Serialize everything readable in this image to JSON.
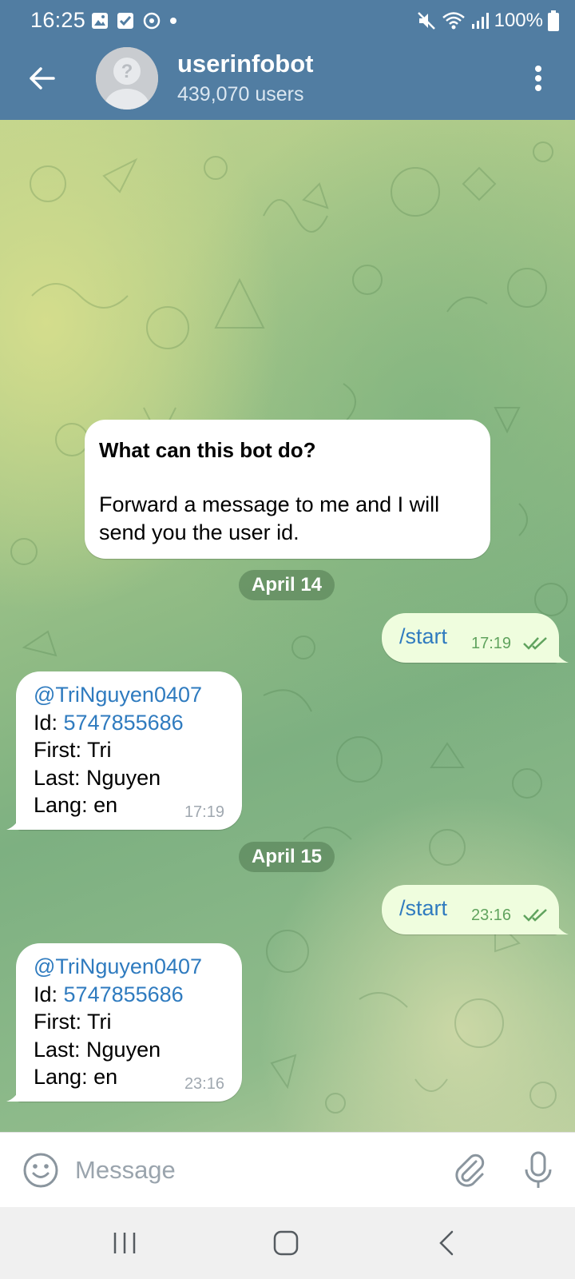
{
  "status_bar": {
    "time": "16:25",
    "battery": "100%"
  },
  "header": {
    "title": "userinfobot",
    "subtitle": "439,070 users"
  },
  "intro": {
    "title": "What can this bot do?",
    "body": "Forward a message to me and I will send you the user id."
  },
  "conversation": [
    {
      "date": "April 14",
      "outgoing": {
        "text": "/start",
        "time": "17:19"
      },
      "reply": {
        "username": "@TriNguyen0407",
        "id_label": "Id: ",
        "id_value": "5747855686",
        "first": "First: Tri",
        "last": "Last: Nguyen",
        "lang": "Lang: en",
        "time": "17:19"
      }
    },
    {
      "date": "April 15",
      "outgoing": {
        "text": "/start",
        "time": "23:16"
      },
      "reply": {
        "username": "@TriNguyen0407",
        "id_label": "Id: ",
        "id_value": "5747855686",
        "first": "First: Tri",
        "last": "Last: Nguyen",
        "lang": "Lang: en",
        "time": "23:16"
      }
    }
  ],
  "composer": {
    "placeholder": "Message",
    "value": ""
  },
  "theme": {
    "header_color": "#517da2",
    "outgoing_bubble": "#effdde",
    "link_color": "#2f7bbf",
    "read_check_color": "#60a35e"
  },
  "icons": {
    "back": "arrow-left-icon",
    "more": "vertical-dots-icon",
    "emoji": "smiley-icon",
    "attach": "paperclip-icon",
    "mic": "microphone-icon",
    "read": "double-check-icon"
  }
}
